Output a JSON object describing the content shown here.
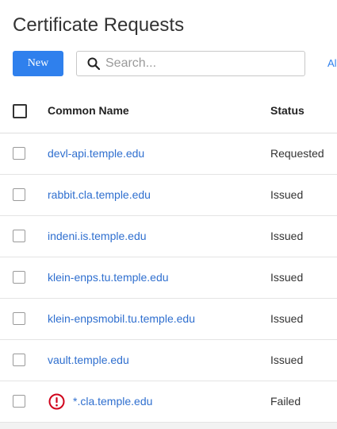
{
  "page": {
    "title": "Certificate Requests"
  },
  "toolbar": {
    "new_label": "New",
    "search_placeholder": "Search...",
    "search_value": "",
    "filter_label": "Al"
  },
  "table": {
    "columns": {
      "common_name": "Common Name",
      "status": "Status"
    },
    "rows": [
      {
        "common_name": "devl-api.temple.edu",
        "status": "Requested",
        "error": false
      },
      {
        "common_name": "rabbit.cla.temple.edu",
        "status": "Issued",
        "error": false
      },
      {
        "common_name": "indeni.is.temple.edu",
        "status": "Issued",
        "error": false
      },
      {
        "common_name": "klein-enps.tu.temple.edu",
        "status": "Issued",
        "error": false
      },
      {
        "common_name": "klein-enpsmobil.tu.temple.edu",
        "status": "Issued",
        "error": false
      },
      {
        "common_name": "vault.temple.edu",
        "status": "Issued",
        "error": false
      },
      {
        "common_name": "*.cla.temple.edu",
        "status": "Failed",
        "error": true
      }
    ]
  },
  "icons": {
    "search": "search-icon",
    "error": "alert-circle-icon"
  },
  "colors": {
    "accent": "#2f80ed",
    "link": "#2f6fcf",
    "error": "#d0021b"
  }
}
